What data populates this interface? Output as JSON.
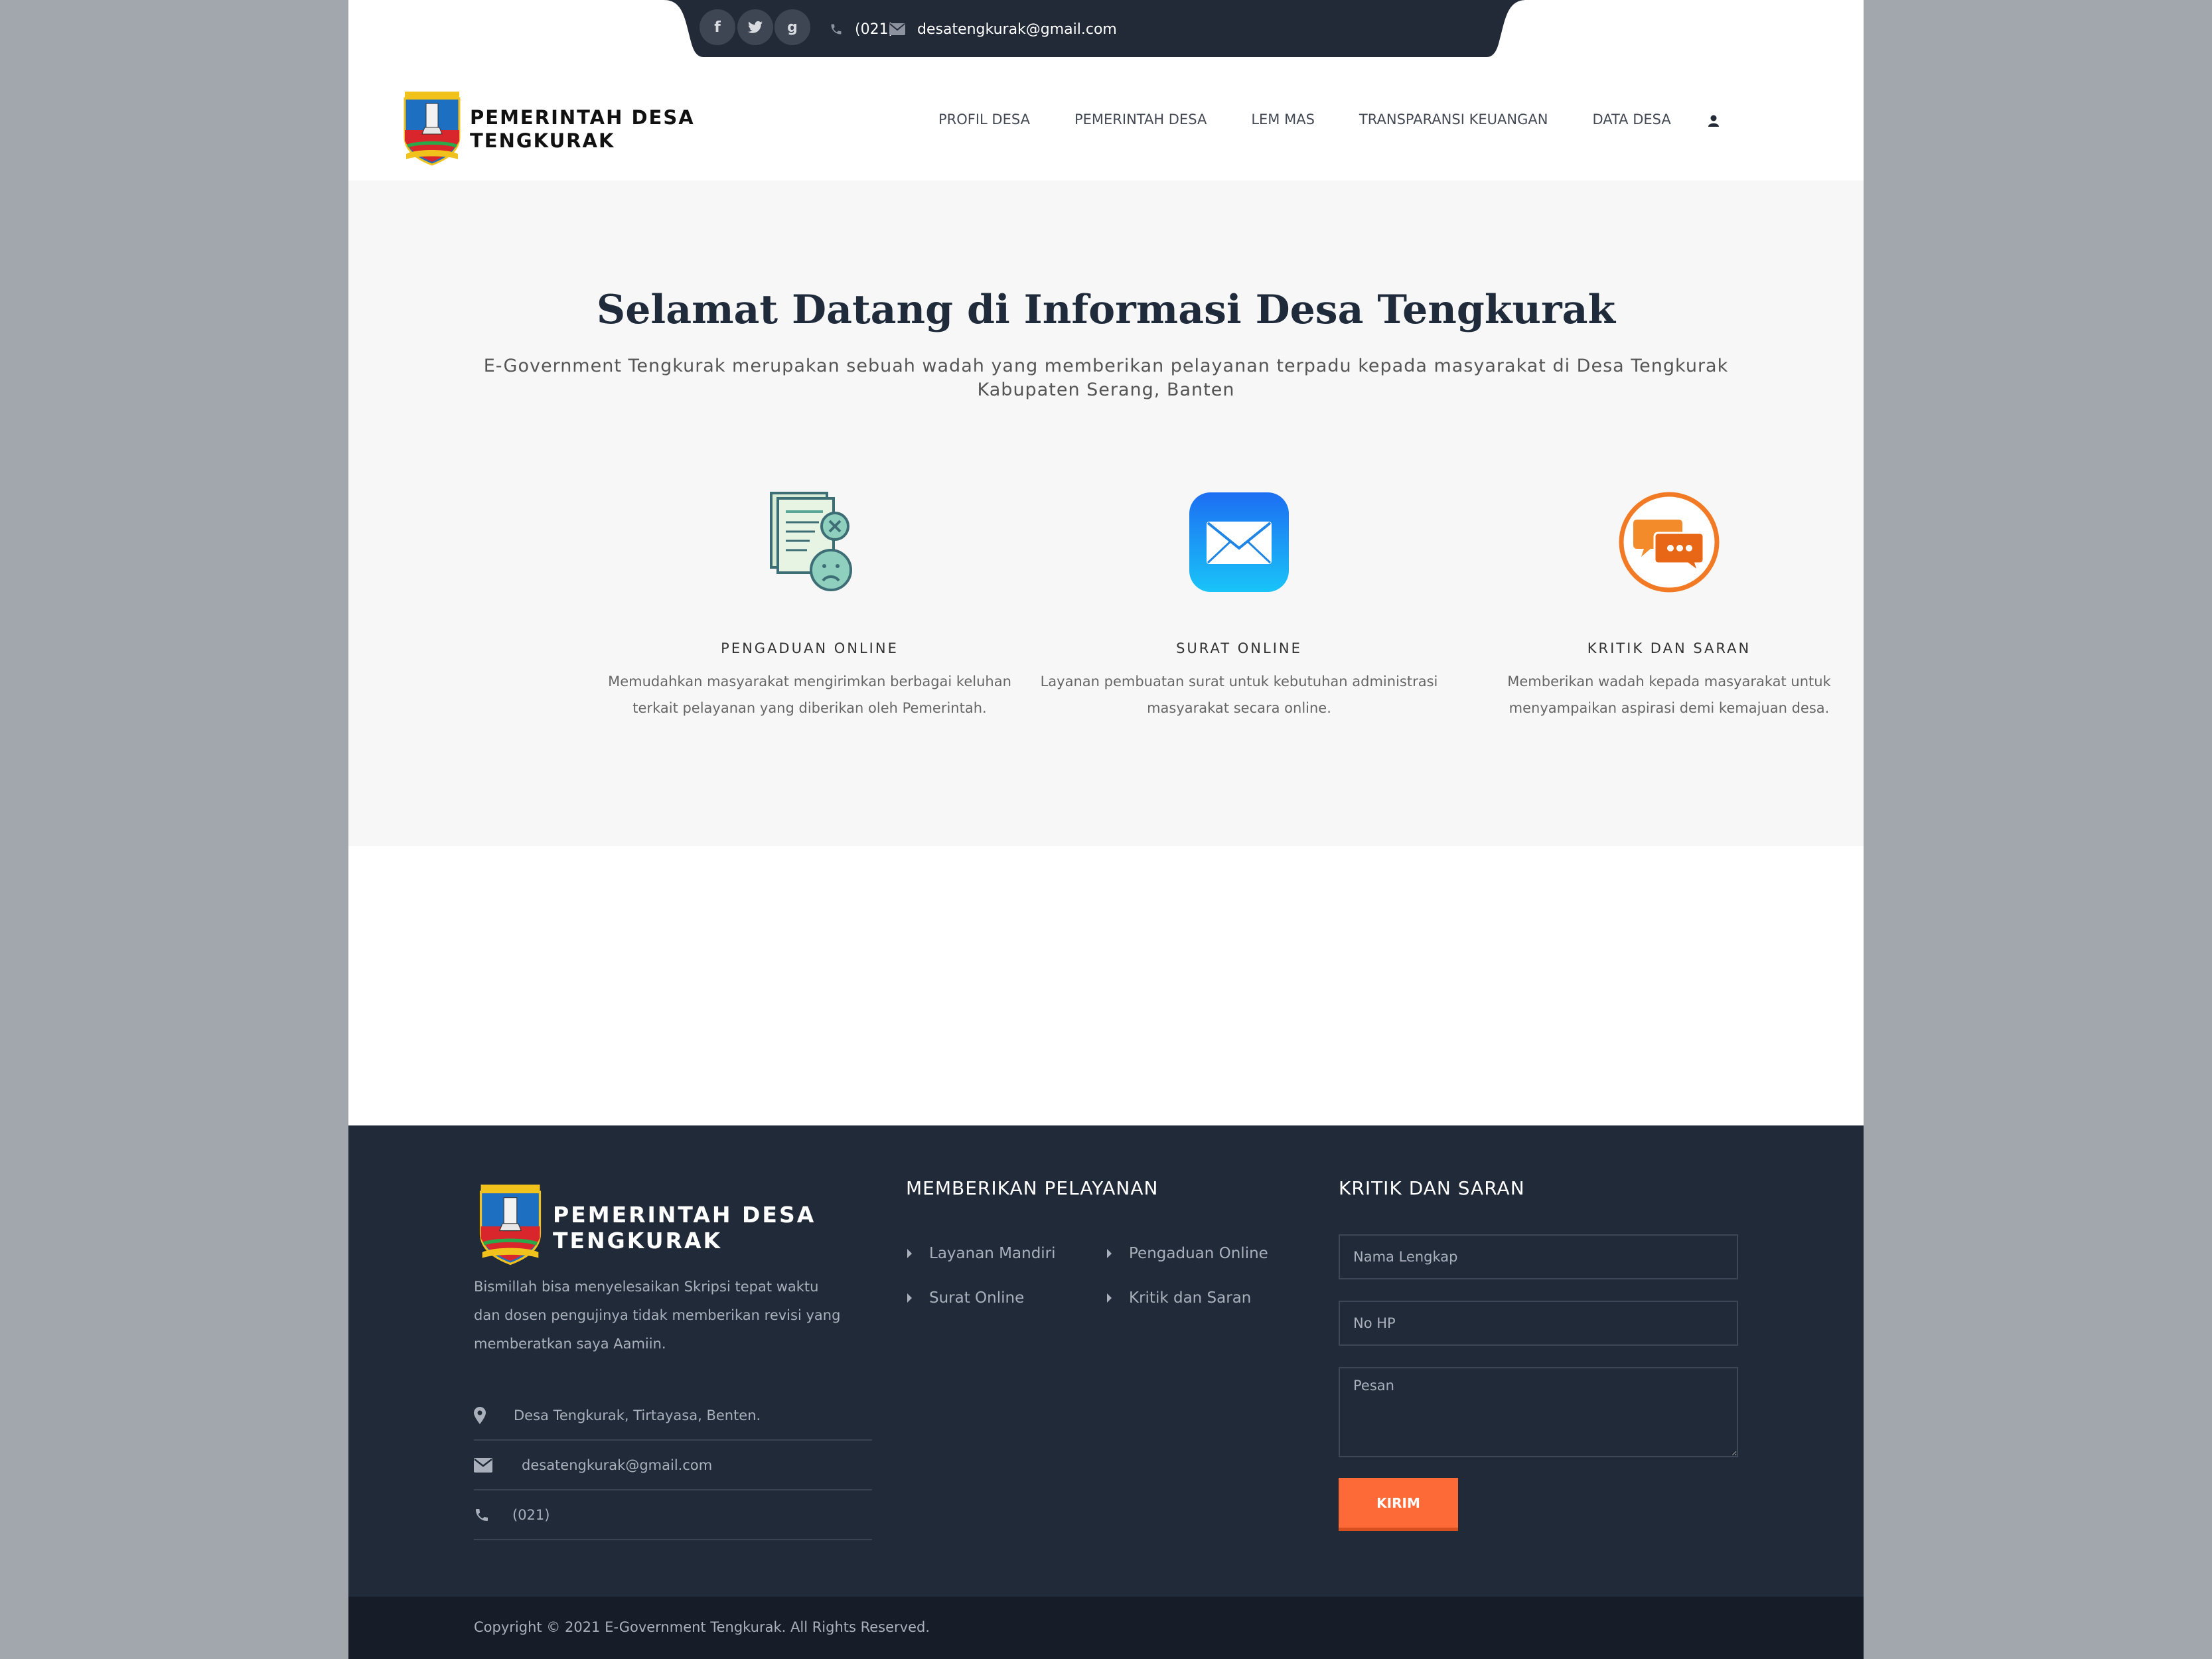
{
  "topbar": {
    "social": [
      {
        "name": "facebook-icon",
        "glyph": "f"
      },
      {
        "name": "twitter-icon",
        "glyph": "t"
      },
      {
        "name": "google-plus-icon",
        "glyph": "g"
      }
    ],
    "phone": "(021)",
    "email": "desatengkurak@gmail.com"
  },
  "header": {
    "brand_line1": "PEMERINTAH DESA",
    "brand_line2": "TENGKURAK",
    "nav": [
      "PROFIL DESA",
      "PEMERINTAH DESA",
      "LEM MAS",
      "TRANSPARANSI KEUANGAN",
      "DATA DESA"
    ]
  },
  "hero": {
    "title": "Selamat Datang di Informasi Desa Tengkurak",
    "subtitle": "E-Government Tengkurak merupakan sebuah wadah yang memberikan pelayanan terpadu kepada masyarakat di Desa Tengkurak Kabupaten Serang, Banten"
  },
  "services": [
    {
      "title": "PENGADUAN ONLINE",
      "desc": "Memudahkan masyarakat mengirimkan berbagai keluhan terkait pelayanan yang diberikan oleh Pemerintah."
    },
    {
      "title": "SURAT ONLINE",
      "desc": "Layanan pembuatan surat untuk kebutuhan administrasi masyarakat secara online."
    },
    {
      "title": "KRITIK DAN SARAN",
      "desc": "Memberikan wadah kepada masyarakat untuk menyampaikan aspirasi demi kemajuan desa."
    }
  ],
  "footer": {
    "brand_line1": "PEMERINTAH DESA",
    "brand_line2": "TENGKURAK",
    "about": "Bismillah bisa menyelesaikan Skripsi tepat waktu dan dosen pengujinya tidak memberikan revisi yang memberatkan saya Aamiin.",
    "address": "Desa Tengkurak, Tirtayasa, Benten.",
    "email": "desatengkurak@gmail.com",
    "phone": "(021)",
    "services_heading": "MEMBERIKAN PELAYANAN",
    "links": [
      "Layanan Mandiri",
      "Pengaduan Online",
      "Surat Online",
      "Kritik dan Saran"
    ],
    "feedback_heading": "KRITIK DAN SARAN",
    "form": {
      "name_placeholder": "Nama Lengkap",
      "phone_placeholder": "No HP",
      "message_placeholder": "Pesan",
      "submit_label": "KIRIM"
    },
    "copyright": "Copyright © 2021 E-Government Tengkurak. All Rights Reserved."
  },
  "colors": {
    "dark_navy": "#212a39",
    "accent_orange": "#fd6a37",
    "hero_bg": "#f7f7f7"
  }
}
